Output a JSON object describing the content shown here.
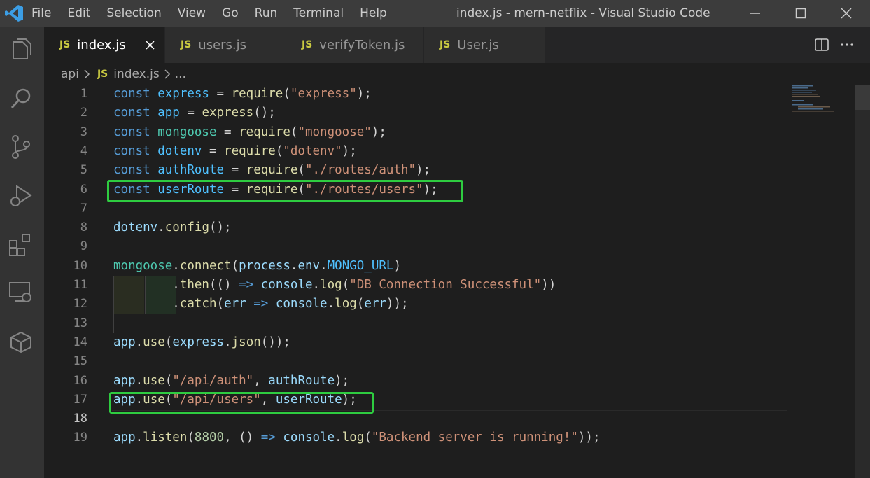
{
  "menu": [
    "File",
    "Edit",
    "Selection",
    "View",
    "Go",
    "Run",
    "Terminal",
    "Help"
  ],
  "window_title": "index.js - mern-netflix - Visual Studio Code",
  "tabs": [
    {
      "icon": "JS",
      "label": "index.js",
      "active": true
    },
    {
      "icon": "JS",
      "label": "users.js",
      "active": false
    },
    {
      "icon": "JS",
      "label": "verifyToken.js",
      "active": false
    },
    {
      "icon": "JS",
      "label": "User.js",
      "active": false
    }
  ],
  "breadcrumb": {
    "folder": "api",
    "icon": "JS",
    "file": "index.js",
    "more": "..."
  },
  "line_numbers": [
    "1",
    "2",
    "3",
    "4",
    "5",
    "6",
    "7",
    "8",
    "9",
    "10",
    "11",
    "12",
    "13",
    "14",
    "15",
    "16",
    "17",
    "18",
    "19"
  ],
  "code_lines": [
    [
      [
        "kw",
        "const "
      ],
      [
        "var",
        "express"
      ],
      [
        "p",
        " = "
      ],
      [
        "fn",
        "require"
      ],
      [
        "p",
        "("
      ],
      [
        "str",
        "\"express\""
      ],
      [
        "p",
        ");"
      ]
    ],
    [
      [
        "kw",
        "const "
      ],
      [
        "var",
        "app"
      ],
      [
        "p",
        " = "
      ],
      [
        "fn",
        "express"
      ],
      [
        "p",
        "();"
      ]
    ],
    [
      [
        "kw",
        "const "
      ],
      [
        "cls",
        "mongoose"
      ],
      [
        "p",
        " = "
      ],
      [
        "fn",
        "require"
      ],
      [
        "p",
        "("
      ],
      [
        "str",
        "\"mongoose\""
      ],
      [
        "p",
        ");"
      ]
    ],
    [
      [
        "kw",
        "const "
      ],
      [
        "var",
        "dotenv"
      ],
      [
        "p",
        " = "
      ],
      [
        "fn",
        "require"
      ],
      [
        "p",
        "("
      ],
      [
        "str",
        "\"dotenv\""
      ],
      [
        "p",
        ");"
      ]
    ],
    [
      [
        "kw",
        "const "
      ],
      [
        "var",
        "authRoute"
      ],
      [
        "p",
        " = "
      ],
      [
        "fn",
        "require"
      ],
      [
        "p",
        "("
      ],
      [
        "str",
        "\"./routes/auth\""
      ],
      [
        "p",
        ");"
      ]
    ],
    [
      [
        "kw",
        "const "
      ],
      [
        "var",
        "userRoute"
      ],
      [
        "p",
        " = "
      ],
      [
        "fn",
        "require"
      ],
      [
        "p",
        "("
      ],
      [
        "str",
        "\"./routes/users\""
      ],
      [
        "p",
        ");"
      ]
    ],
    [],
    [
      [
        "prop",
        "dotenv"
      ],
      [
        "p",
        "."
      ],
      [
        "fn",
        "config"
      ],
      [
        "p",
        "();"
      ]
    ],
    [],
    [
      [
        "cls",
        "mongoose"
      ],
      [
        "p",
        "."
      ],
      [
        "fn",
        "connect"
      ],
      [
        "p",
        "("
      ],
      [
        "prop",
        "process"
      ],
      [
        "p",
        "."
      ],
      [
        "prop",
        "env"
      ],
      [
        "p",
        "."
      ],
      [
        "var",
        "MONGO_URL"
      ],
      [
        "p",
        ")"
      ]
    ],
    [
      [
        "p",
        "        ."
      ],
      [
        "fn",
        "then"
      ],
      [
        "p",
        "(() "
      ],
      [
        "kw",
        "=>"
      ],
      [
        "p",
        " "
      ],
      [
        "prop",
        "console"
      ],
      [
        "p",
        "."
      ],
      [
        "fn",
        "log"
      ],
      [
        "p",
        "("
      ],
      [
        "str",
        "\"DB Connection Successful\""
      ],
      [
        "p",
        "))"
      ]
    ],
    [
      [
        "p",
        "        ."
      ],
      [
        "fn",
        "catch"
      ],
      [
        "p",
        "("
      ],
      [
        "prop",
        "err"
      ],
      [
        "p",
        " "
      ],
      [
        "kw",
        "=>"
      ],
      [
        "p",
        " "
      ],
      [
        "prop",
        "console"
      ],
      [
        "p",
        "."
      ],
      [
        "fn",
        "log"
      ],
      [
        "p",
        "("
      ],
      [
        "prop",
        "err"
      ],
      [
        "p",
        "));"
      ]
    ],
    [],
    [
      [
        "prop",
        "app"
      ],
      [
        "p",
        "."
      ],
      [
        "fn",
        "use"
      ],
      [
        "p",
        "("
      ],
      [
        "prop",
        "express"
      ],
      [
        "p",
        "."
      ],
      [
        "fn",
        "json"
      ],
      [
        "p",
        "());"
      ]
    ],
    [],
    [
      [
        "prop",
        "app"
      ],
      [
        "p",
        "."
      ],
      [
        "fn",
        "use"
      ],
      [
        "p",
        "("
      ],
      [
        "str",
        "\"/api/auth\""
      ],
      [
        "p",
        ", "
      ],
      [
        "prop",
        "authRoute"
      ],
      [
        "p",
        ");"
      ]
    ],
    [
      [
        "prop",
        "app"
      ],
      [
        "p",
        "."
      ],
      [
        "fn",
        "use"
      ],
      [
        "p",
        "("
      ],
      [
        "str",
        "\"/api/users\""
      ],
      [
        "p",
        ", "
      ],
      [
        "prop",
        "userRoute"
      ],
      [
        "p",
        ");"
      ]
    ],
    [],
    [
      [
        "prop",
        "app"
      ],
      [
        "p",
        "."
      ],
      [
        "fn",
        "listen"
      ],
      [
        "p",
        "("
      ],
      [
        "num",
        "8800"
      ],
      [
        "p",
        ", () "
      ],
      [
        "kw",
        "=>"
      ],
      [
        "p",
        " "
      ],
      [
        "prop",
        "console"
      ],
      [
        "p",
        "."
      ],
      [
        "fn",
        "log"
      ],
      [
        "p",
        "("
      ],
      [
        "str",
        "\"Backend server is running!\""
      ],
      [
        "p",
        "));"
      ]
    ]
  ]
}
